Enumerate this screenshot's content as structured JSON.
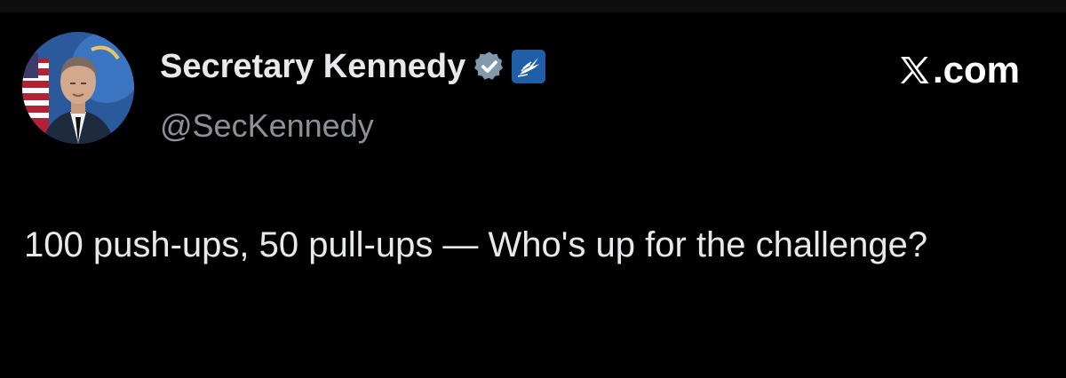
{
  "post": {
    "author": {
      "display_name": "Secretary Kennedy",
      "handle": "@SecKennedy",
      "verified_badge_icon": "verified-badge-icon",
      "affiliate_icon": "hhs-eagle-icon",
      "verified_color": "#829aab",
      "affiliate_color": "#1f5fa8"
    },
    "text": "100 push-ups, 50 pull-ups — Who's up for the challenge?"
  },
  "brand": {
    "label": ".com",
    "logo_icon": "x-logo-icon"
  },
  "colors": {
    "background": "#000000",
    "text_primary": "#e7e9ea",
    "text_secondary": "#8b9196"
  }
}
